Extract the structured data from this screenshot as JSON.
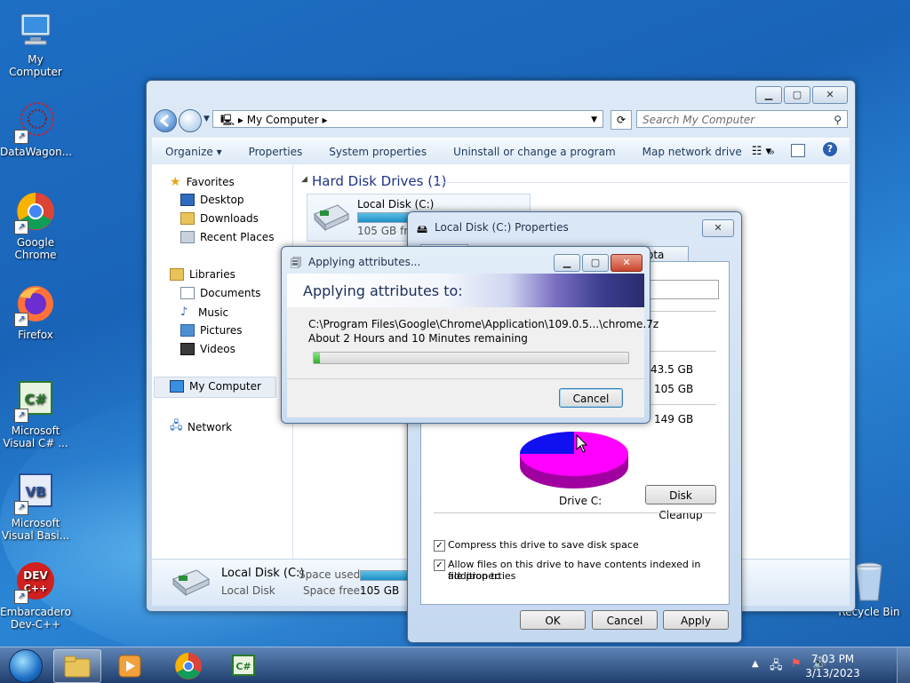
{
  "desktop": {
    "icons": [
      {
        "label": "My Computer"
      },
      {
        "label": "DataWagon..."
      },
      {
        "label": "Google Chrome"
      },
      {
        "label": "Firefox"
      },
      {
        "label": "Microsoft Visual C# ..."
      },
      {
        "label": "Microsoft Visual Basi..."
      },
      {
        "label": "Embarcadero Dev-C++"
      },
      {
        "label": "Recycle Bin"
      }
    ]
  },
  "explorer": {
    "address": "My Computer",
    "search_placeholder": "Search My Computer",
    "toolbar": [
      "Organize",
      "Properties",
      "System properties",
      "Uninstall or change a program",
      "Map network drive",
      "»"
    ],
    "nav": {
      "favorites": "Favorites",
      "desktop": "Desktop",
      "downloads": "Downloads",
      "recent": "Recent Places",
      "libraries": "Libraries",
      "documents": "Documents",
      "music": "Music",
      "pictures": "Pictures",
      "videos": "Videos",
      "computer": "My Computer",
      "network": "Network"
    },
    "section": "Hard Disk Drives (1)",
    "drive": {
      "name": "Local Disk (C:)",
      "free": "105 GB free",
      "used_fraction": 0.3
    },
    "details": {
      "name": "Local Disk (C:)",
      "type": "Local Disk",
      "used_label": "Space used:",
      "free_label": "Space free:",
      "free_value": "105 GB"
    }
  },
  "props": {
    "title": "Local Disk (C:) Properties",
    "tab_partial": "ota",
    "used_space": "43.5 GB",
    "free_space": "105 GB",
    "capacity": "149 GB",
    "drive_label": "Drive C:",
    "disk_cleanup": "Disk Cleanup",
    "compress": "Compress this drive to save disk space",
    "index_line1": "Allow files on this drive to have contents indexed in addition to",
    "index_line2": "file properties",
    "ok": "OK",
    "cancel": "Cancel",
    "apply": "Apply"
  },
  "applying": {
    "title": "Applying attributes...",
    "banner": "Applying attributes to:",
    "path": "C:\\Program Files\\Google\\Chrome\\Application\\109.0.5...\\chrome.7z",
    "remaining": "About 2 Hours and 10 Minutes remaining",
    "progress_fraction": 0.02,
    "cancel": "Cancel"
  },
  "taskbar": {
    "time": "7:03 PM",
    "date": "3/13/2023"
  }
}
